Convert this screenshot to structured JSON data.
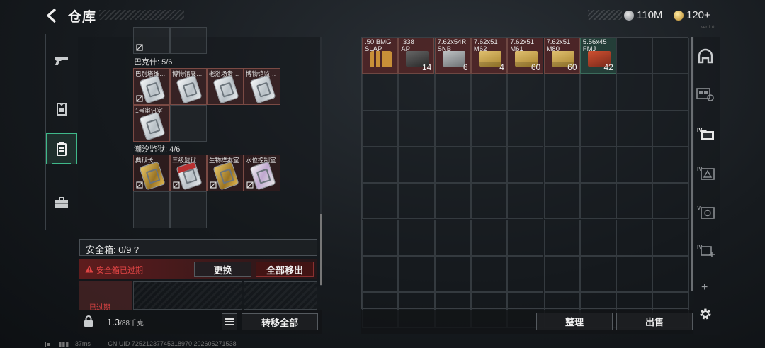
{
  "header": {
    "title": "仓库",
    "currency_silver": "110M",
    "currency_gold": "120+",
    "version": "ver 1.0"
  },
  "nav": {
    "items": [
      {
        "name": "weapons",
        "icon": "gun-icon"
      },
      {
        "name": "armor",
        "icon": "armor-icon"
      },
      {
        "name": "cards",
        "icon": "card-icon",
        "active": true
      },
      {
        "name": "storage",
        "icon": "toolbox-icon"
      }
    ]
  },
  "safebox": {
    "groups": [
      {
        "label": "巴克什: 5/6",
        "items": [
          "巴别塔维…",
          "博物馆展…",
          "老浴场贵…",
          "博物馆监…",
          "1号审讯室"
        ]
      },
      {
        "label": "潮汐监狱: 4/6",
        "items": [
          "典狱长",
          "三级监狱…",
          "生物样本室",
          "水位控制室"
        ]
      }
    ],
    "capacity_text": "安全箱: 0/9  ?",
    "expired_text": "安全箱已过期",
    "replace_button": "更换",
    "move_all_out_button": "全部移出",
    "expired_badge": "已过期"
  },
  "bottom_left": {
    "weight_value": "1.3",
    "weight_max": "/88千克",
    "transfer_all_button": "转移全部"
  },
  "stash": {
    "items": [
      {
        "name": ".50 BMG\nSLAP",
        "count": "",
        "color": "red",
        "icon": "bullets"
      },
      {
        "name": ".338\nAP",
        "count": "14",
        "color": "red",
        "icon": "dark"
      },
      {
        "name": "7.62x54R\nSNB",
        "count": "6",
        "color": "red",
        "icon": "grey"
      },
      {
        "name": "7.62x51\nM62",
        "count": "4",
        "color": "red",
        "icon": "tan"
      },
      {
        "name": "7.62x51\nM61",
        "count": "60",
        "color": "red",
        "icon": "tan"
      },
      {
        "name": "7.62x51\nM80",
        "count": "60",
        "color": "red",
        "icon": "tan"
      },
      {
        "name": "5.56x45\nFMJ",
        "count": "42",
        "color": "green",
        "icon": "red"
      }
    ],
    "sort_button": "整理",
    "sell_button": "出售"
  },
  "rail": {
    "items": [
      "helmet-icon",
      "gear-rack-icon",
      "card-folder-icon",
      "card-alert-icon",
      "card-target-icon",
      "card-add-icon"
    ],
    "add_label": "+"
  },
  "status": {
    "ping": "37ms",
    "uid": "CN UID 72521237745318970 202605271538"
  },
  "colors": {
    "accent_green": "#3fb98a",
    "warning_red": "#e04444",
    "item_red": "#7a4a44"
  }
}
